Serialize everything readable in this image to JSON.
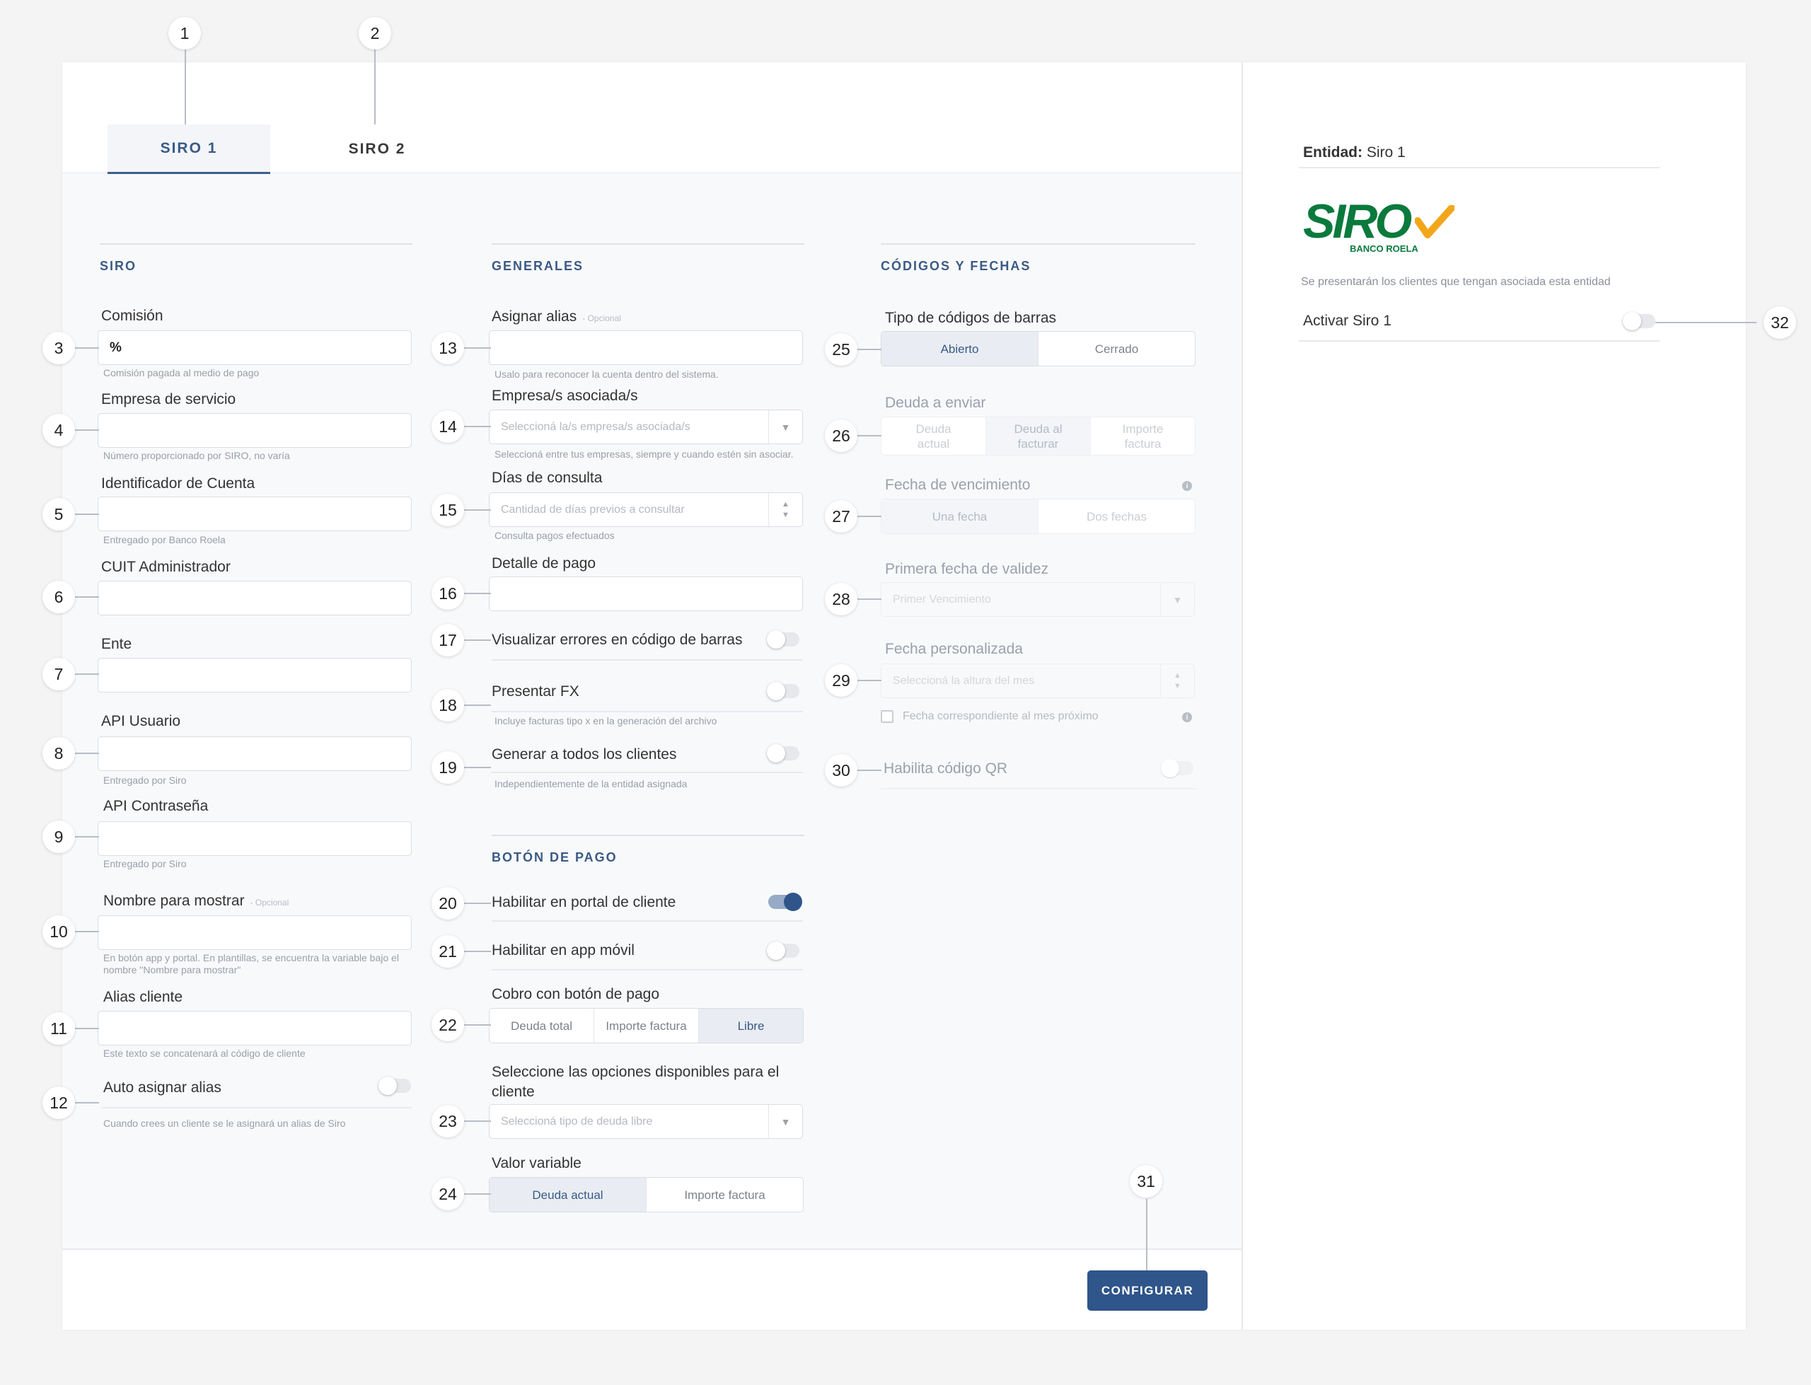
{
  "tabs": [
    {
      "label": "SIRO 1"
    },
    {
      "label": "SIRO 2"
    }
  ],
  "callouts": [
    "1",
    "2",
    "3",
    "4",
    "5",
    "6",
    "7",
    "8",
    "9",
    "10",
    "11",
    "12",
    "13",
    "14",
    "15",
    "16",
    "17",
    "18",
    "19",
    "20",
    "21",
    "22",
    "23",
    "24",
    "25",
    "26",
    "27",
    "28",
    "29",
    "30",
    "31",
    "32"
  ],
  "siro": {
    "title": "SIRO",
    "comision": {
      "label": "Comisión",
      "value": "%",
      "helper": "Comisión pagada al medio de pago"
    },
    "empresa": {
      "label": "Empresa de servicio",
      "helper": "Número proporcionado por SIRO, no varía"
    },
    "identificador": {
      "label": "Identificador de Cuenta",
      "helper": "Entregado por Banco Roela"
    },
    "cuit": {
      "label": "CUIT Administrador"
    },
    "ente": {
      "label": "Ente"
    },
    "api_usuario": {
      "label": "API Usuario",
      "helper": "Entregado por Siro"
    },
    "api_pass": {
      "label": "API Contraseña",
      "helper": "Entregado por Siro"
    },
    "nombre": {
      "label": "Nombre para mostrar",
      "optional": "- Opcional",
      "helper": "En botón app y portal. En plantillas, se encuentra la variable bajo el nombre \"Nombre para mostrar\""
    },
    "alias_cliente": {
      "label": "Alias cliente",
      "helper": "Este texto se concatenará al código de cliente"
    },
    "auto_alias": {
      "label": "Auto asignar alias",
      "helper": "Cuando crees un cliente se le asignará un alias de Siro",
      "on": false
    }
  },
  "generales": {
    "title": "GENERALES",
    "alias": {
      "label": "Asignar alias",
      "optional": "- Opcional",
      "helper": "Usalo para reconocer la cuenta dentro del sistema."
    },
    "empresas": {
      "label": "Empresa/s asociada/s",
      "placeholder": "Seleccioná la/s empresa/s asociada/s",
      "helper": "Seleccioná entre tus empresas, siempre y cuando estén sin asociar."
    },
    "dias": {
      "label": "Días de consulta",
      "placeholder": "Cantidad de días previos a consultar",
      "helper": "Consulta pagos efectuados"
    },
    "detalle": {
      "label": "Detalle de pago"
    },
    "errores": {
      "label": "Visualizar errores en código de barras",
      "on": false
    },
    "fx": {
      "label": "Presentar FX",
      "helper": "Incluye facturas tipo x en la generación del archivo",
      "on": false
    },
    "todos": {
      "label": "Generar a todos los clientes",
      "helper": "Independientemente de la entidad asignada",
      "on": false
    }
  },
  "boton": {
    "title": "BOTÓN DE PAGO",
    "portal": {
      "label": "Habilitar en portal de cliente",
      "on": true
    },
    "app": {
      "label": "Habilitar en app móvil",
      "on": false
    },
    "cobro": {
      "label": "Cobro con botón de pago",
      "options": [
        "Deuda total",
        "Importe factura",
        "Libre"
      ],
      "selected": "Libre"
    },
    "opciones": {
      "label": "Seleccione las opciones disponibles para el cliente",
      "placeholder": "Seleccioná tipo de deuda libre"
    },
    "valor": {
      "label": "Valor variable",
      "options": [
        "Deuda actual",
        "Importe factura"
      ],
      "selected": "Deuda actual"
    }
  },
  "codigos": {
    "title": "CÓDIGOS Y FECHAS",
    "tipo": {
      "label": "Tipo de códigos de barras",
      "options": [
        "Abierto",
        "Cerrado"
      ],
      "selected": "Abierto"
    },
    "deuda": {
      "label": "Deuda a enviar",
      "options": [
        "Deuda actual",
        "Deuda al facturar",
        "Importe factura"
      ],
      "selected": "Deuda al facturar"
    },
    "vencimiento": {
      "label": "Fecha de vencimiento",
      "options": [
        "Una fecha",
        "Dos fechas"
      ],
      "selected": "Una fecha"
    },
    "primera": {
      "label": "Primera fecha de validez",
      "placeholder": "Primer Vencimiento"
    },
    "personalizada": {
      "label": "Fecha personalizada",
      "placeholder": "Seleccioná la altura del mes",
      "checkbox": "Fecha correspondiente al mes próximo"
    },
    "qr": {
      "label": "Habilita código QR",
      "on": false
    }
  },
  "configurar": "CONFIGURAR",
  "side": {
    "entidad_label": "Entidad:",
    "entidad_value": "Siro 1",
    "logo_text": "SIRO",
    "logo_sub": "BANCO ROELA",
    "note": "Se presentarán los clientes que tengan asociada esta entidad",
    "activar": {
      "label": "Activar Siro 1",
      "on": false
    }
  },
  "colors": {
    "accent": "#2f558a",
    "heading": "#3a5a85",
    "logo_green": "#0a7a3c",
    "logo_orange": "#f2a71b"
  }
}
